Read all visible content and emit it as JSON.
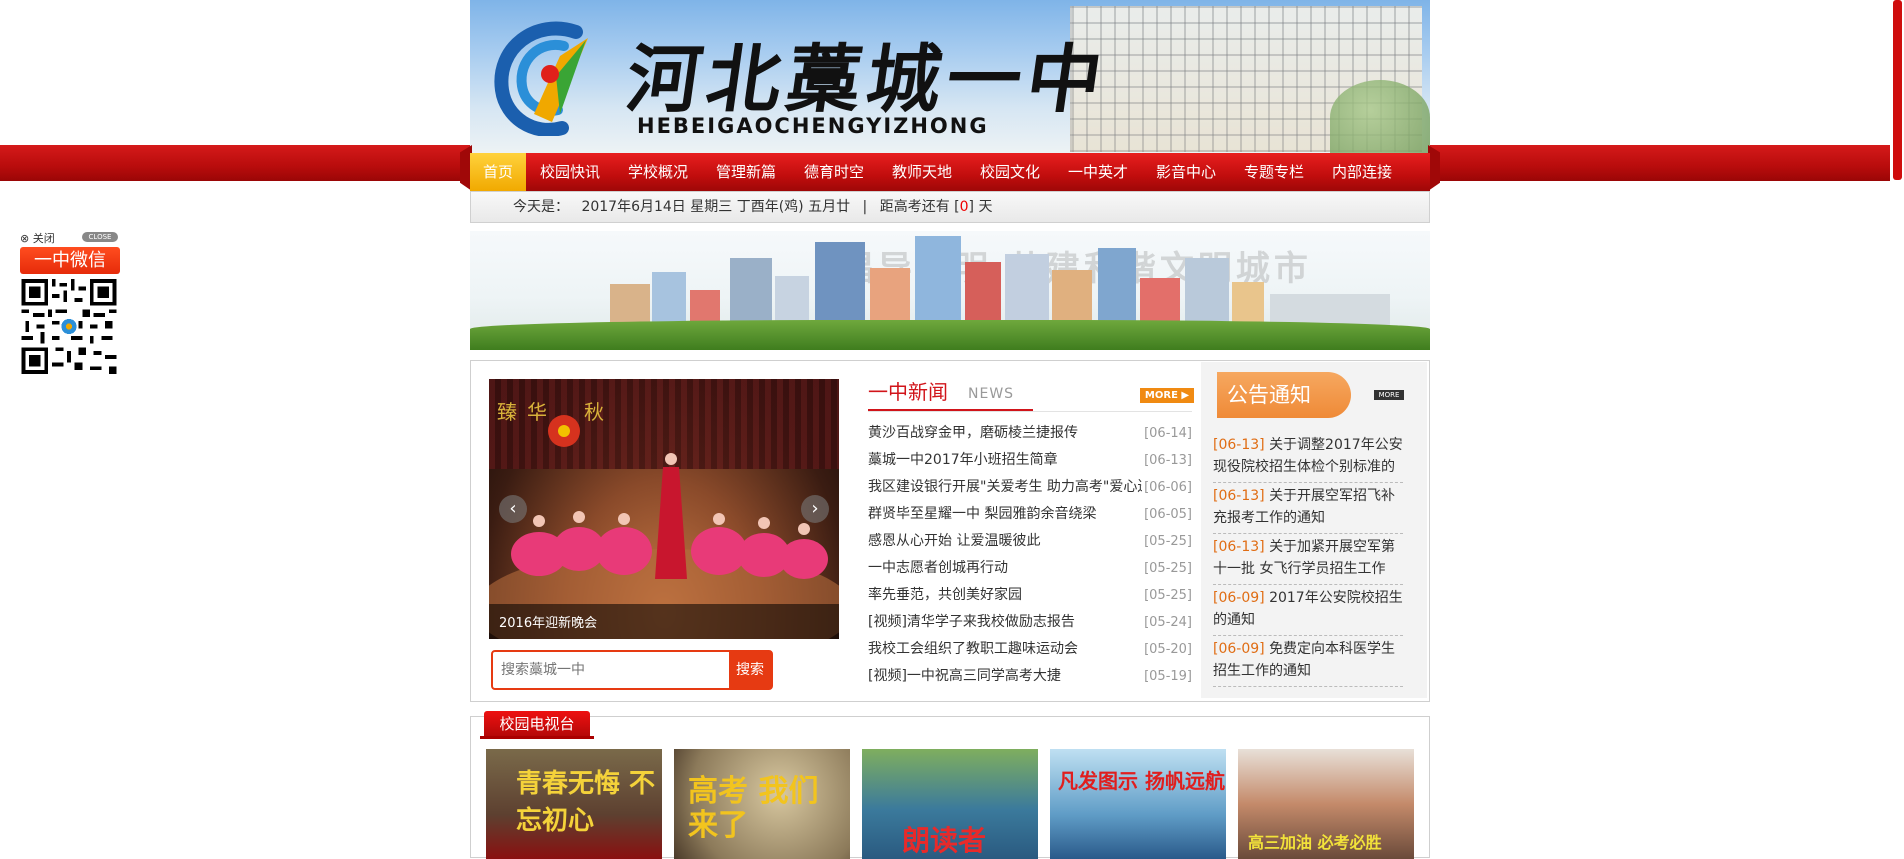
{
  "banner": {
    "title": "河北藁城一中",
    "pinyin": "HEBEIGAOCHENGYIZHONG"
  },
  "nav": {
    "items": [
      {
        "label": "首页",
        "active": true
      },
      {
        "label": "校园快讯"
      },
      {
        "label": "学校概况"
      },
      {
        "label": "管理新篇"
      },
      {
        "label": "德育时空"
      },
      {
        "label": "教师天地"
      },
      {
        "label": "校园文化"
      },
      {
        "label": "一中英才"
      },
      {
        "label": "影音中心"
      },
      {
        "label": "专题专栏"
      },
      {
        "label": "内部连接"
      }
    ]
  },
  "datebar": {
    "prefix": "今天是：",
    "date": "2017年6月14日 星期三 丁酉年(鸡) 五月廿",
    "separator": "|",
    "countdown_prefix": "距高考还有 [",
    "countdown_value": "0",
    "countdown_suffix": "] 天"
  },
  "city_banner": {
    "slogan": "倡导文明 共建和谐文明城市"
  },
  "slideshow": {
    "caption": "2016年迎新晚会",
    "prev_icon": "‹",
    "next_icon": "›"
  },
  "search": {
    "placeholder": "搜索藁城一中",
    "button_label": "搜索"
  },
  "news": {
    "title": "一中新闻",
    "subtitle": "NEWS",
    "more_label": "MORE ▶",
    "items": [
      {
        "title": "黄沙百战穿金甲，磨砺棱兰捷报传",
        "date": "[06-14]"
      },
      {
        "title": "藁城一中2017年小班招生简章",
        "date": "[06-13]"
      },
      {
        "title": "我区建设银行开展\"关爱考生 助力高考\"爱心送",
        "date": "[06-06]"
      },
      {
        "title": "群贤毕至星耀一中 梨园雅韵余音绕梁",
        "date": "[06-05]"
      },
      {
        "title": "感恩从心开始 让爱温暖彼此",
        "date": "[05-25]"
      },
      {
        "title": "一中志愿者创城再行动",
        "date": "[05-25]"
      },
      {
        "title": "率先垂范，共创美好家园",
        "date": "[05-25]"
      },
      {
        "title": "[视频]清华学子来我校做励志报告",
        "date": "[05-24]"
      },
      {
        "title": "我校工会组织了教职工趣味运动会",
        "date": "[05-20]"
      },
      {
        "title": "[视频]一中祝高三同学高考大捷",
        "date": "[05-19]"
      }
    ]
  },
  "notice": {
    "title": "公告通知",
    "more_label": "MORE",
    "items": [
      {
        "date": "[06-13]",
        "text": "关于调整2017年公安现役院校招生体检个别标准的"
      },
      {
        "date": "[06-13]",
        "text": "关于开展空军招飞补充报考工作的通知"
      },
      {
        "date": "[06-13]",
        "text": "关于加紧开展空军第十一批 女飞行学员招生工作"
      },
      {
        "date": "[06-09]",
        "text": "2017年公安院校招生的通知"
      },
      {
        "date": "[06-09]",
        "text": "免费定向本科医学生招生工作的通知"
      }
    ]
  },
  "tv": {
    "title": "校园电视台",
    "thumbs": [
      {
        "text": "青春无悔 不忘初心"
      },
      {
        "text": "高考 我们来了"
      },
      {
        "text": "朗读者"
      },
      {
        "text": "凡发图示 扬帆远航"
      },
      {
        "text": "高三加油 必考必胜"
      }
    ]
  },
  "wechat": {
    "close_label": "⊗ 关闭",
    "close_pill": "CLOSE",
    "button_label": "一中微信"
  },
  "colors": {
    "brand_red": "#c10d0d",
    "active_tab": "#f1a900",
    "notice_orange": "#ef8a37",
    "accent_orange": "#e63a12"
  }
}
